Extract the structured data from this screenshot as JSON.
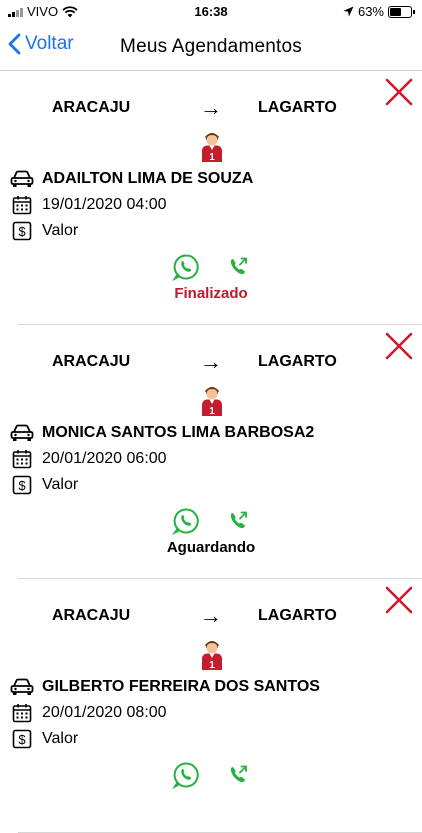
{
  "status_bar": {
    "carrier": "VIVO",
    "time": "16:38",
    "battery": "63%",
    "battery_level": 0.63
  },
  "nav": {
    "back_label": "Voltar",
    "title": "Meus Agendamentos"
  },
  "colors": {
    "accent": "#1a73e8",
    "close": "#d0182e",
    "finalizado": "#c0182a",
    "whatsapp": "#25b33f"
  },
  "bookings": [
    {
      "from": "ARACAJU",
      "to": "LAGARTO",
      "driver": "ADAILTON LIMA DE SOUZA",
      "datetime": "19/01/2020 04:00",
      "value_label": "Valor",
      "seat": "1",
      "status": "Finalizado",
      "status_color": "#c0182a"
    },
    {
      "from": "ARACAJU",
      "to": "LAGARTO",
      "driver": "MONICA SANTOS LIMA BARBOSA2",
      "datetime": "20/01/2020 06:00",
      "value_label": "Valor",
      "seat": "1",
      "status": "Aguardando",
      "status_color": "#000000"
    },
    {
      "from": "ARACAJU",
      "to": "LAGARTO",
      "driver": "GILBERTO FERREIRA DOS SANTOS",
      "datetime": "20/01/2020 08:00",
      "value_label": "Valor",
      "seat": "1",
      "status": "",
      "status_color": "#000000"
    }
  ],
  "icons": [
    "signal-icon",
    "wifi-icon",
    "location-arrow-icon",
    "battery-icon",
    "chevron-left-icon",
    "close-icon",
    "driver-icon",
    "car-icon",
    "calendar-icon",
    "dollar-icon",
    "whatsapp-icon",
    "phone-icon"
  ]
}
